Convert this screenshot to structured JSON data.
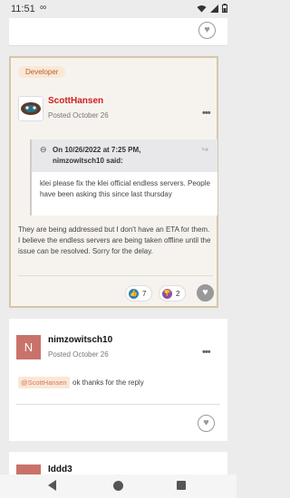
{
  "status_bar": {
    "time": "11:51",
    "glyph": "∞",
    "icons": [
      "wifi-icon",
      "signal-icon",
      "battery-icon"
    ]
  },
  "post1": {
    "badge": "Developer",
    "author": "ScottHansen",
    "posted": "Posted October 26",
    "quote": {
      "header": "On 10/26/2022 at 7:25 PM, nimzowitsch10 said:",
      "body": "klei please fix the klei official endless servers. People have been asking this since last thursday"
    },
    "body": "They are being addressed but I don't have an ETA for them. I believe the endless servers are being taken offline until the issue can be resolved. Sorry for the delay.",
    "reactions": [
      {
        "icon": "thumbs-up-icon",
        "count": "7",
        "color": "#2a7fb8"
      },
      {
        "icon": "trophy-icon",
        "count": "2",
        "color": "#8a4fa3"
      }
    ]
  },
  "post2": {
    "avatar_letter": "N",
    "author": "nimzowitsch10",
    "posted": "Posted October 26",
    "mention": "@ScottHansen",
    "body": "ok thanks for the reply"
  },
  "post3": {
    "author_fragment": "Iddd3"
  },
  "colors": {
    "accent": "#d01f1f",
    "highlight_border": "#d5c7a8",
    "badge_bg": "#fbe7d6"
  }
}
